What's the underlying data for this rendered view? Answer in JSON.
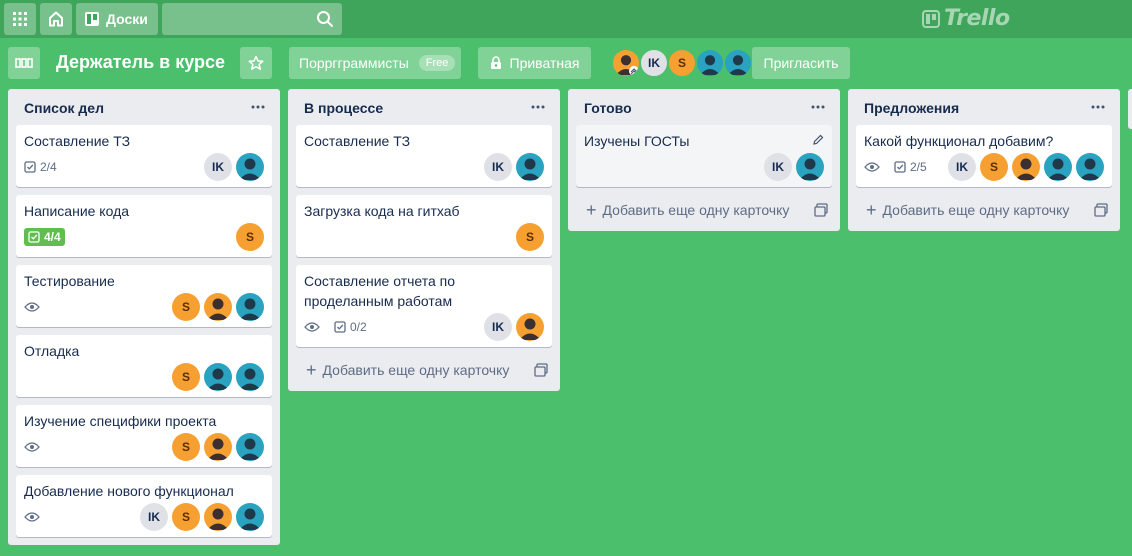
{
  "topbar": {
    "boards_label": "Доски",
    "search_value": "",
    "logo_text": "Trello"
  },
  "board": {
    "title": "Держатель в курсе",
    "team_label": "Порргграммисты",
    "team_badge": "Free",
    "visibility_label": "Приватная",
    "invite_label": "Пригласить",
    "members": [
      "owner-photo",
      "IK",
      "S",
      "teal-user",
      "teal-user"
    ]
  },
  "lists": [
    {
      "title": "Список дел",
      "cards": [
        {
          "title": "Составление ТЗ",
          "checklist": "2/4",
          "members": [
            "IK",
            "teal"
          ]
        },
        {
          "title": "Написание кода",
          "checklist_done": "4/4",
          "members": [
            "S"
          ]
        },
        {
          "title": "Тестирование",
          "watch": true,
          "members": [
            "S",
            "orange",
            "teal"
          ]
        },
        {
          "title": "Отладка",
          "members": [
            "S",
            "teal",
            "teal"
          ]
        },
        {
          "title": "Изучение специфики проекта",
          "watch": true,
          "members": [
            "S",
            "orange",
            "teal"
          ]
        },
        {
          "title": "Добавление нового функционал",
          "watch": true,
          "members": [
            "IK",
            "S",
            "orange",
            "teal"
          ]
        }
      ]
    },
    {
      "title": "В процессе",
      "cards": [
        {
          "title": "Составление ТЗ",
          "members": [
            "IK",
            "teal"
          ]
        },
        {
          "title": "Загрузка кода на гитхаб",
          "members": [
            "S"
          ]
        },
        {
          "title": "Составление отчета по проделанным работам",
          "watch": true,
          "checklist": "0/2",
          "members": [
            "IK",
            "orange"
          ]
        }
      ],
      "add_label": "Добавить еще одну карточку"
    },
    {
      "title": "Готово",
      "cards": [
        {
          "title": "Изучены ГОСТы",
          "members": [
            "IK",
            "teal"
          ]
        }
      ],
      "add_label": "Добавить еще одну карточку"
    },
    {
      "title": "Предложения",
      "cards": [
        {
          "title": "Какой функционал добавим?",
          "watch": true,
          "checklist": "2/5",
          "members": [
            "IK",
            "S",
            "orange",
            "teal",
            "teal"
          ]
        }
      ],
      "add_label": "Добавить еще одну карточку"
    }
  ],
  "colors": {
    "board_bg": "#4bbf6b",
    "topbar_bg": "#3ea55b",
    "list_bg": "#ebecf0",
    "checklist_done": "#61bd4f",
    "avatar_orange": "#f7a032",
    "avatar_teal": "#29a3c0",
    "avatar_grey": "#dfe1e6"
  }
}
